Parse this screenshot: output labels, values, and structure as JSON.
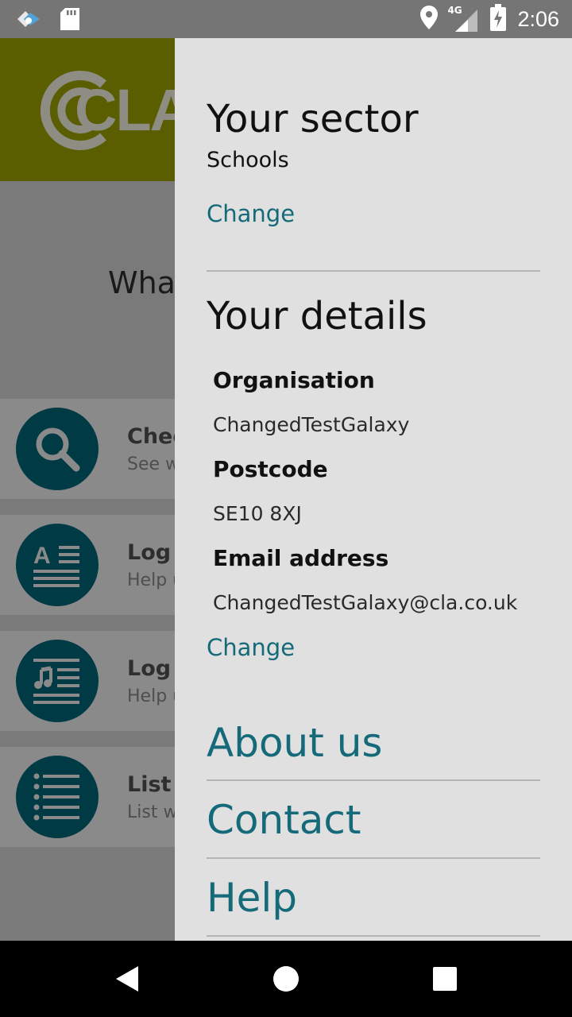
{
  "status_bar": {
    "time": "2:06",
    "network_type": "4G",
    "icons": [
      "cast-icon",
      "sd-card-icon",
      "location-icon",
      "signal-icon",
      "battery-charging-icon"
    ]
  },
  "background_app": {
    "logo_text": "CLA",
    "question_text": "Wha",
    "rows": [
      {
        "icon": "search-icon",
        "title": "Chec",
        "subtitle": "See w"
      },
      {
        "icon": "text-lines-icon",
        "title": "Log c",
        "subtitle": "Help u"
      },
      {
        "icon": "music-lines-icon",
        "title": "Log c",
        "subtitle": "Help u"
      },
      {
        "icon": "list-icon",
        "title": "List l",
        "subtitle": "List w"
      }
    ],
    "colors": {
      "header": "#5a5d00",
      "icon_circle": "#003b45"
    }
  },
  "drawer": {
    "sector": {
      "heading": "Your sector",
      "value": "Schools",
      "change_label": "Change"
    },
    "details": {
      "heading": "Your details",
      "fields": [
        {
          "label": "Organisation",
          "value": "ChangedTestGalaxy"
        },
        {
          "label": "Postcode",
          "value": "SE10 8XJ"
        },
        {
          "label": "Email address",
          "value": "ChangedTestGalaxy@cla.co.uk"
        }
      ],
      "change_label": "Change"
    },
    "links": [
      {
        "label": "About us"
      },
      {
        "label": "Contact"
      },
      {
        "label": "Help"
      }
    ],
    "colors": {
      "link": "#156a7a",
      "background": "#e0e0e0"
    }
  },
  "nav_bar": {
    "icons": [
      "back-icon",
      "home-icon",
      "recents-icon"
    ]
  }
}
